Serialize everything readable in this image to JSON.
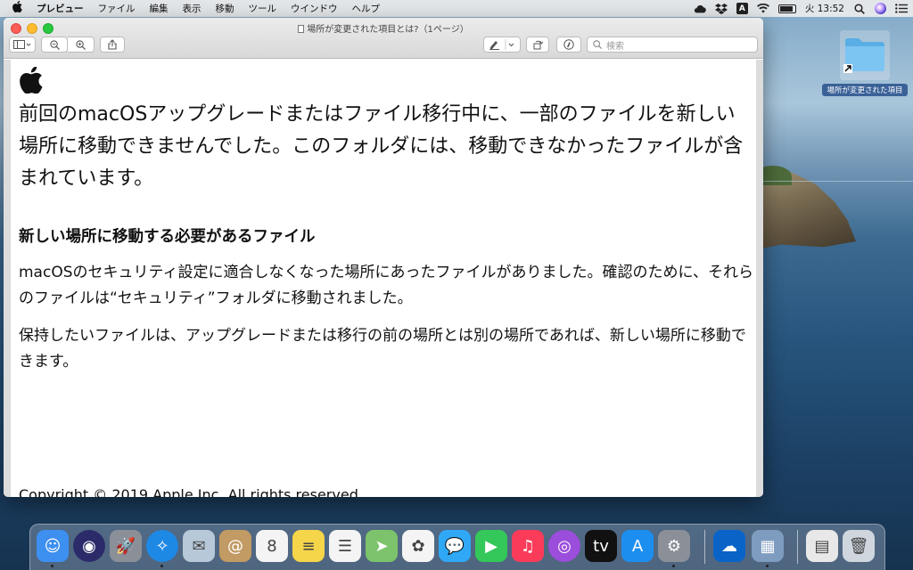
{
  "menubar": {
    "apple": "",
    "items": [
      "プレビュー",
      "ファイル",
      "編集",
      "表示",
      "移動",
      "ツール",
      "ウインドウ",
      "ヘルプ"
    ],
    "clock": "火 13:52",
    "input_method": "A"
  },
  "window": {
    "title": "場所が変更された項目とは?（1ページ）",
    "search_placeholder": "検索"
  },
  "document": {
    "intro": "前回のmacOSアップグレードまたはファイル移行中に、一部のファイルを新しい場所に移動できませんでした。このフォルダには、移動できなかったファイルが含まれています。",
    "heading": "新しい場所に移動する必要があるファイル",
    "para1": "macOSのセキュリティ設定に適合しなくなった場所にあったファイルがありました。確認のために、それらのファイルは“セキュリティ”フォルダに移動されました。",
    "para2": "保持したいファイルは、アップグレードまたは移行の前の場所とは別の場所であれば、新しい場所に移動できます。",
    "copyright": "Copyright © 2019 Apple Inc. All rights reserved."
  },
  "desktop": {
    "folder_label": "場所が変更された項目"
  },
  "dock": {
    "apps": [
      {
        "name": "finder-icon",
        "color": "#3d8ff0",
        "glyph": "☺",
        "running": true
      },
      {
        "name": "siri-icon",
        "color": "#2b2b6a",
        "glyph": "◉",
        "running": false
      },
      {
        "name": "launchpad-icon",
        "color": "#8a8f98",
        "glyph": "🚀",
        "running": false
      },
      {
        "name": "safari-icon",
        "color": "#1e88e5",
        "glyph": "✧",
        "running": true
      },
      {
        "name": "mail-icon",
        "color": "#b7c8d8",
        "glyph": "✉",
        "running": false
      },
      {
        "name": "contacts-icon",
        "color": "#c29a63",
        "glyph": "@",
        "running": false
      },
      {
        "name": "calendar-icon",
        "color": "#f4f4f4",
        "glyph": "8",
        "running": false
      },
      {
        "name": "notes-icon",
        "color": "#f5d54a",
        "glyph": "≡",
        "running": false
      },
      {
        "name": "reminders-icon",
        "color": "#f4f4f4",
        "glyph": "☰",
        "running": false
      },
      {
        "name": "maps-icon",
        "color": "#7cc36b",
        "glyph": "➤",
        "running": false
      },
      {
        "name": "photos-icon",
        "color": "#f4f4f4",
        "glyph": "✿",
        "running": false
      },
      {
        "name": "messages-icon",
        "color": "#2fa8f5",
        "glyph": "💬",
        "running": false
      },
      {
        "name": "facetime-icon",
        "color": "#34c759",
        "glyph": "▶",
        "running": false
      },
      {
        "name": "music-icon",
        "color": "#fa3c5a",
        "glyph": "♫",
        "running": false
      },
      {
        "name": "podcasts-icon",
        "color": "#9b4ddb",
        "glyph": "◎",
        "running": false
      },
      {
        "name": "apple-tv-icon",
        "color": "#111111",
        "glyph": "tv",
        "running": false
      },
      {
        "name": "app-store-icon",
        "color": "#1c8ef0",
        "glyph": "A",
        "running": false
      },
      {
        "name": "system-preferences-icon",
        "color": "#8a8f98",
        "glyph": "⚙",
        "running": true
      },
      {
        "name": "onedrive-icon",
        "color": "#0a64c8",
        "glyph": "☁",
        "running": false
      },
      {
        "name": "preview-icon",
        "color": "#7e9cbf",
        "glyph": "▦",
        "running": true
      },
      {
        "name": "document-icon",
        "color": "#e8e8e8",
        "glyph": "▤",
        "running": false
      },
      {
        "name": "trash-icon",
        "color": "#cfd6de",
        "glyph": "🗑",
        "running": false
      }
    ]
  }
}
